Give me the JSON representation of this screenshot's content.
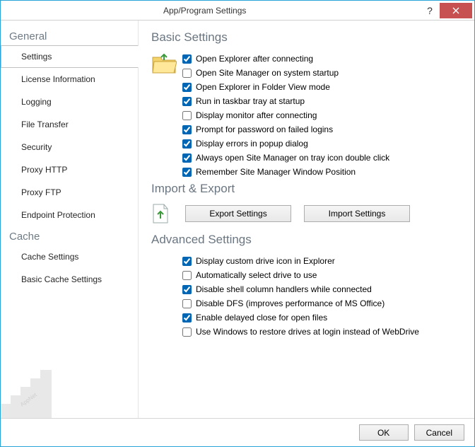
{
  "window": {
    "title": "App/Program Settings"
  },
  "nav": {
    "groups": [
      {
        "header": "General",
        "items": [
          "Settings",
          "License Information",
          "Logging",
          "File Transfer",
          "Security",
          "Proxy HTTP",
          "Proxy FTP",
          "Endpoint Protection"
        ],
        "activeIndex": 0
      },
      {
        "header": "Cache",
        "items": [
          "Cache Settings",
          "Basic Cache Settings"
        ],
        "activeIndex": -1
      }
    ]
  },
  "sections": {
    "basic": {
      "title": "Basic Settings",
      "items": [
        {
          "label": "Open Explorer after connecting",
          "checked": true
        },
        {
          "label": "Open Site Manager on system startup",
          "checked": false
        },
        {
          "label": "Open Explorer in Folder View mode",
          "checked": true
        },
        {
          "label": "Run in taskbar tray at startup",
          "checked": true
        },
        {
          "label": "Display monitor after connecting",
          "checked": false
        },
        {
          "label": "Prompt for password on failed logins",
          "checked": true
        },
        {
          "label": "Display errors in popup dialog",
          "checked": true
        },
        {
          "label": "Always open Site Manager on tray icon double click",
          "checked": true
        },
        {
          "label": "Remember Site Manager Window Position",
          "checked": true
        }
      ]
    },
    "importExport": {
      "title": "Import & Export",
      "exportLabel": "Export Settings",
      "importLabel": "Import Settings"
    },
    "advanced": {
      "title": "Advanced Settings",
      "items": [
        {
          "label": "Display custom drive icon in Explorer",
          "checked": true
        },
        {
          "label": "Automatically select drive to use",
          "checked": false
        },
        {
          "label": "Disable shell column handlers while connected",
          "checked": true
        },
        {
          "label": "Disable DFS (improves performance of MS Office)",
          "checked": false
        },
        {
          "label": "Enable delayed close for open files",
          "checked": true
        },
        {
          "label": "Use Windows to restore drives at login instead of WebDrive",
          "checked": false
        }
      ]
    }
  },
  "footer": {
    "ok": "OK",
    "cancel": "Cancel"
  }
}
